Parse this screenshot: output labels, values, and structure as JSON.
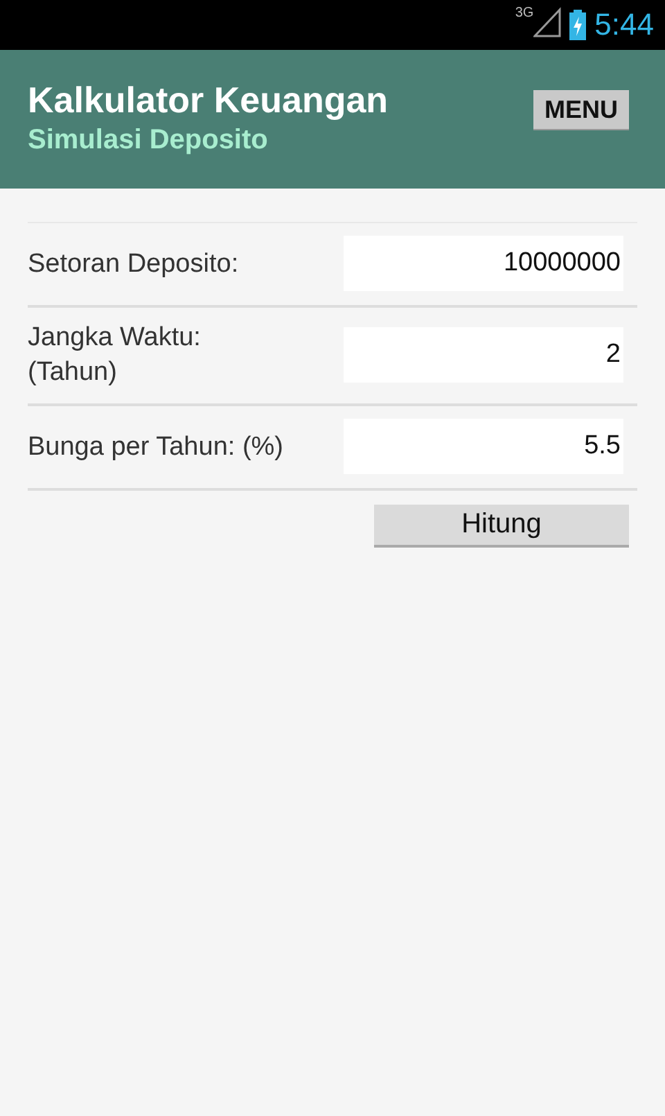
{
  "status_bar": {
    "network": "3G",
    "time": "5:44"
  },
  "header": {
    "title": "Kalkulator Keuangan",
    "subtitle": "Simulasi Deposito",
    "menu_button": "MENU"
  },
  "form": {
    "rows": [
      {
        "label": "Setoran Deposito:",
        "value": "10000000"
      },
      {
        "label": "Jangka Waktu:\n(Tahun)",
        "value": "2"
      },
      {
        "label": "Bunga per Tahun: (%)",
        "value": "5.5"
      }
    ],
    "button": "Hitung"
  }
}
